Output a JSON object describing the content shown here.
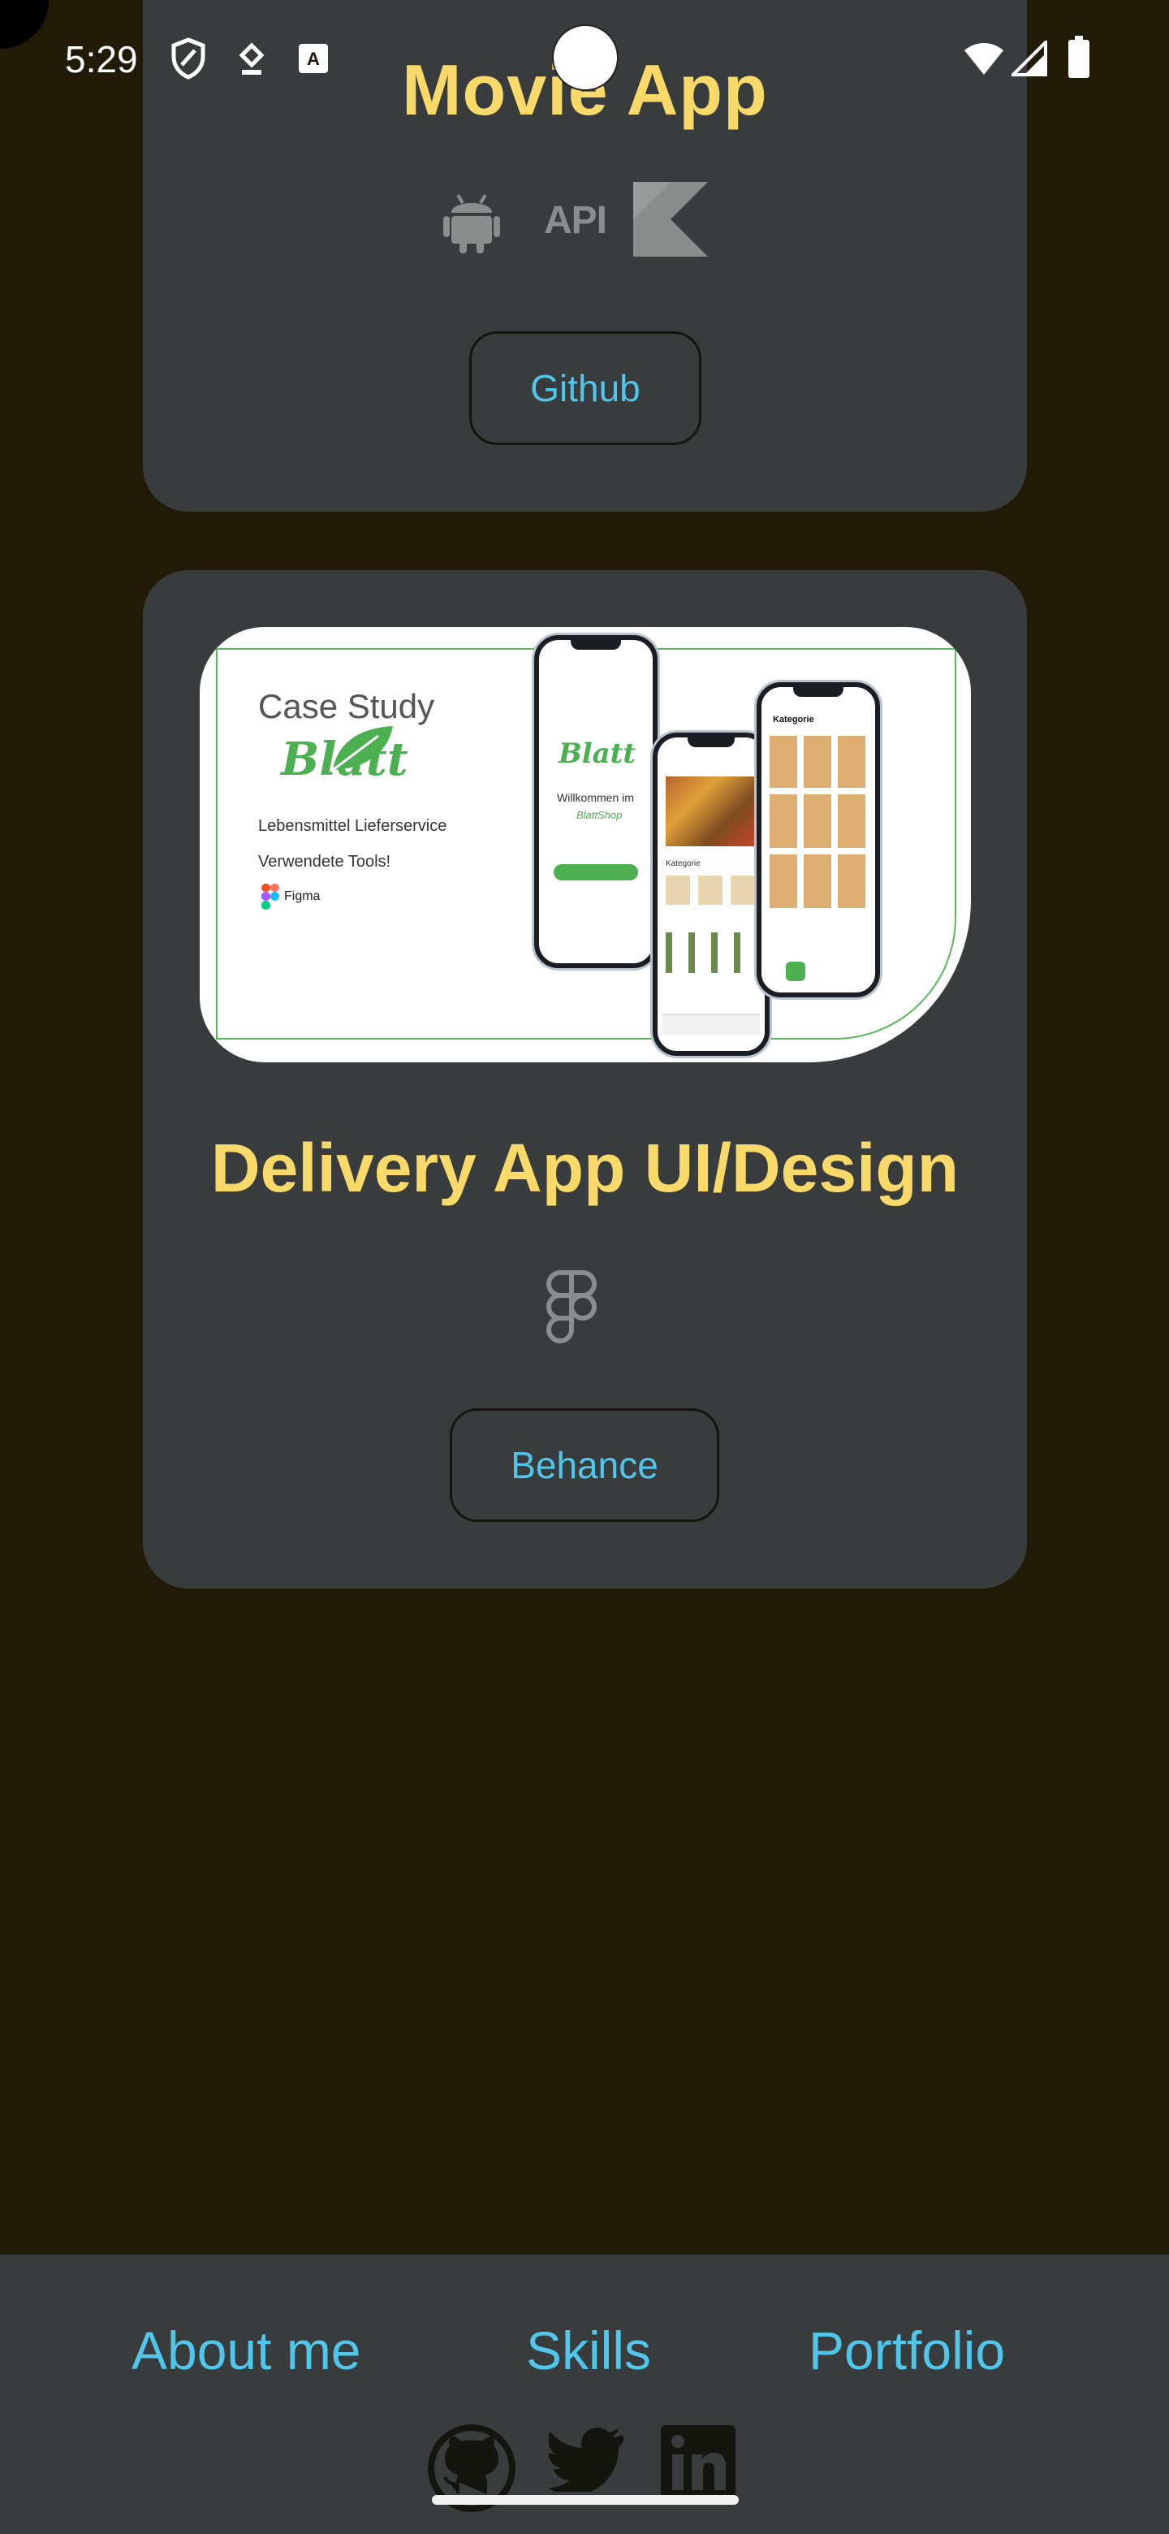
{
  "status_bar": {
    "time": "5:29",
    "icons": [
      "shield-icon",
      "location-pin-icon",
      "keyboard-a-icon",
      "wifi-icon",
      "signal-icon",
      "battery-icon"
    ]
  },
  "projects": [
    {
      "title": "Movie App",
      "tech_icons": [
        "android-icon",
        "api-icon",
        "kotlin-icon"
      ],
      "api_label": "API",
      "button_label": "Github"
    },
    {
      "title": "Delivery App UI/Design",
      "tech_icons": [
        "figma-icon"
      ],
      "button_label": "Behance",
      "image": {
        "case_title": "Case Study",
        "brand": "Blatt",
        "subtitle_1": "Lebensmittel Lieferservice",
        "subtitle_2": "Verwendete Tools!",
        "tool": "Figma"
      }
    }
  ],
  "bottom_nav": {
    "about": "About me",
    "skills": "Skills",
    "portfolio": "Portfolio",
    "social_icons": [
      "github-icon",
      "twitter-icon",
      "linkedin-icon"
    ]
  },
  "colors": {
    "background": "#211a06",
    "card": "#383c3d",
    "title": "#f8d96a",
    "link": "#52c6ea",
    "icon_gray": "#8b8c8c"
  }
}
